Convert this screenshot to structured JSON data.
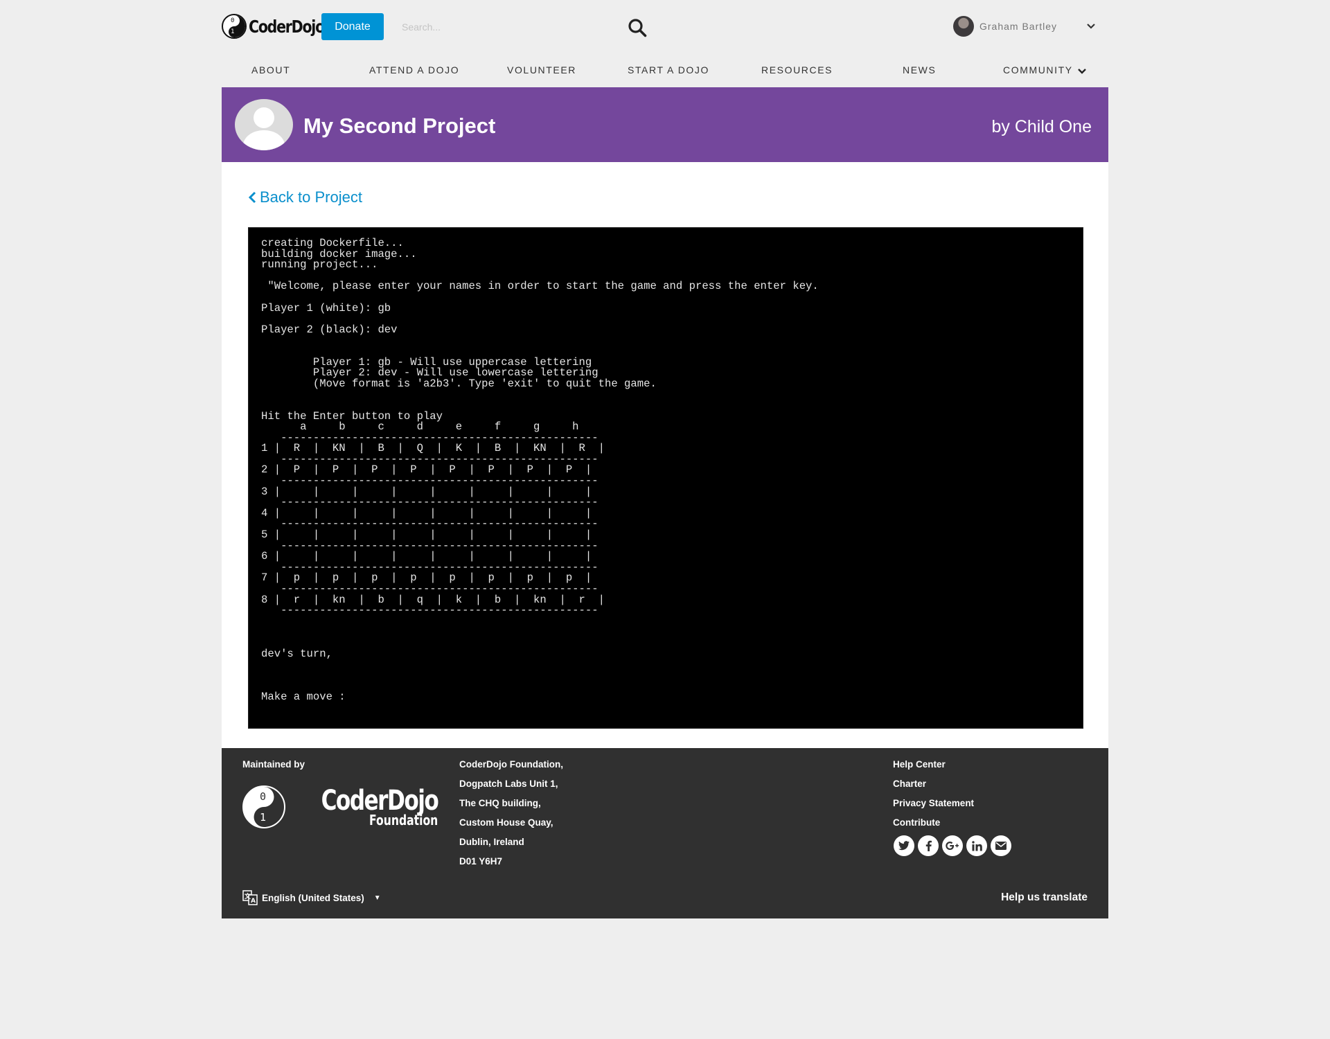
{
  "header": {
    "logo_text": "CoderDojo",
    "donate_label": "Donate",
    "search_placeholder": "Search...",
    "user_name": "Graham Bartley"
  },
  "nav": {
    "items": [
      "ABOUT",
      "ATTEND A DOJO",
      "VOLUNTEER",
      "START A DOJO",
      "RESOURCES",
      "NEWS",
      "COMMUNITY"
    ]
  },
  "banner": {
    "title": "My Second Project",
    "author": "by Child One",
    "color": "#74479c"
  },
  "main": {
    "back_label": "Back to Project",
    "terminal_output": "creating Dockerfile...\nbuilding docker image...\nrunning project...\n\n \"Welcome, please enter your names in order to start the game and press the enter key.\n\nPlayer 1 (white): gb\n\nPlayer 2 (black): dev\n\n\n        Player 1: gb - Will use uppercase lettering\n        Player 2: dev - Will use lowercase lettering\n        (Move format is 'a2b3'. Type 'exit' to quit the game.\n\n\nHit the Enter button to play\n      a     b     c     d     e     f     g     h\n   -------------------------------------------------\n1 |  R  |  KN  |  B  |  Q  |  K  |  B  |  KN  |  R  |\n   -------------------------------------------------\n2 |  P  |  P  |  P  |  P  |  P  |  P  |  P  |  P  |\n   -------------------------------------------------\n3 |     |     |     |     |     |     |     |     |\n   -------------------------------------------------\n4 |     |     |     |     |     |     |     |     |\n   -------------------------------------------------\n5 |     |     |     |     |     |     |     |     |\n   -------------------------------------------------\n6 |     |     |     |     |     |     |     |     |\n   -------------------------------------------------\n7 |  p  |  p  |  p  |  p  |  p  |  p  |  p  |  p  |\n   -------------------------------------------------\n8 |  r  |  kn  |  b  |  q  |  k  |  b  |  kn  |  r  |\n   -------------------------------------------------\n\n\n\ndev's turn,\n\n\n\nMake a move :"
  },
  "footer": {
    "maintained_by": "Maintained by",
    "logo_line1": "CoderDojo",
    "logo_line2": "Foundation",
    "address": [
      "CoderDojo Foundation,",
      "Dogpatch Labs Unit 1,",
      "The CHQ building,",
      "Custom House Quay,",
      "Dublin, Ireland",
      "D01 Y6H7"
    ],
    "links": [
      "Help Center",
      "Charter",
      "Privacy Statement",
      "Contribute"
    ],
    "social_icons": [
      "twitter-icon",
      "facebook-icon",
      "google-plus-icon",
      "linkedin-icon",
      "email-icon"
    ],
    "language": "English (United States)",
    "translate_label": "Help us translate"
  }
}
